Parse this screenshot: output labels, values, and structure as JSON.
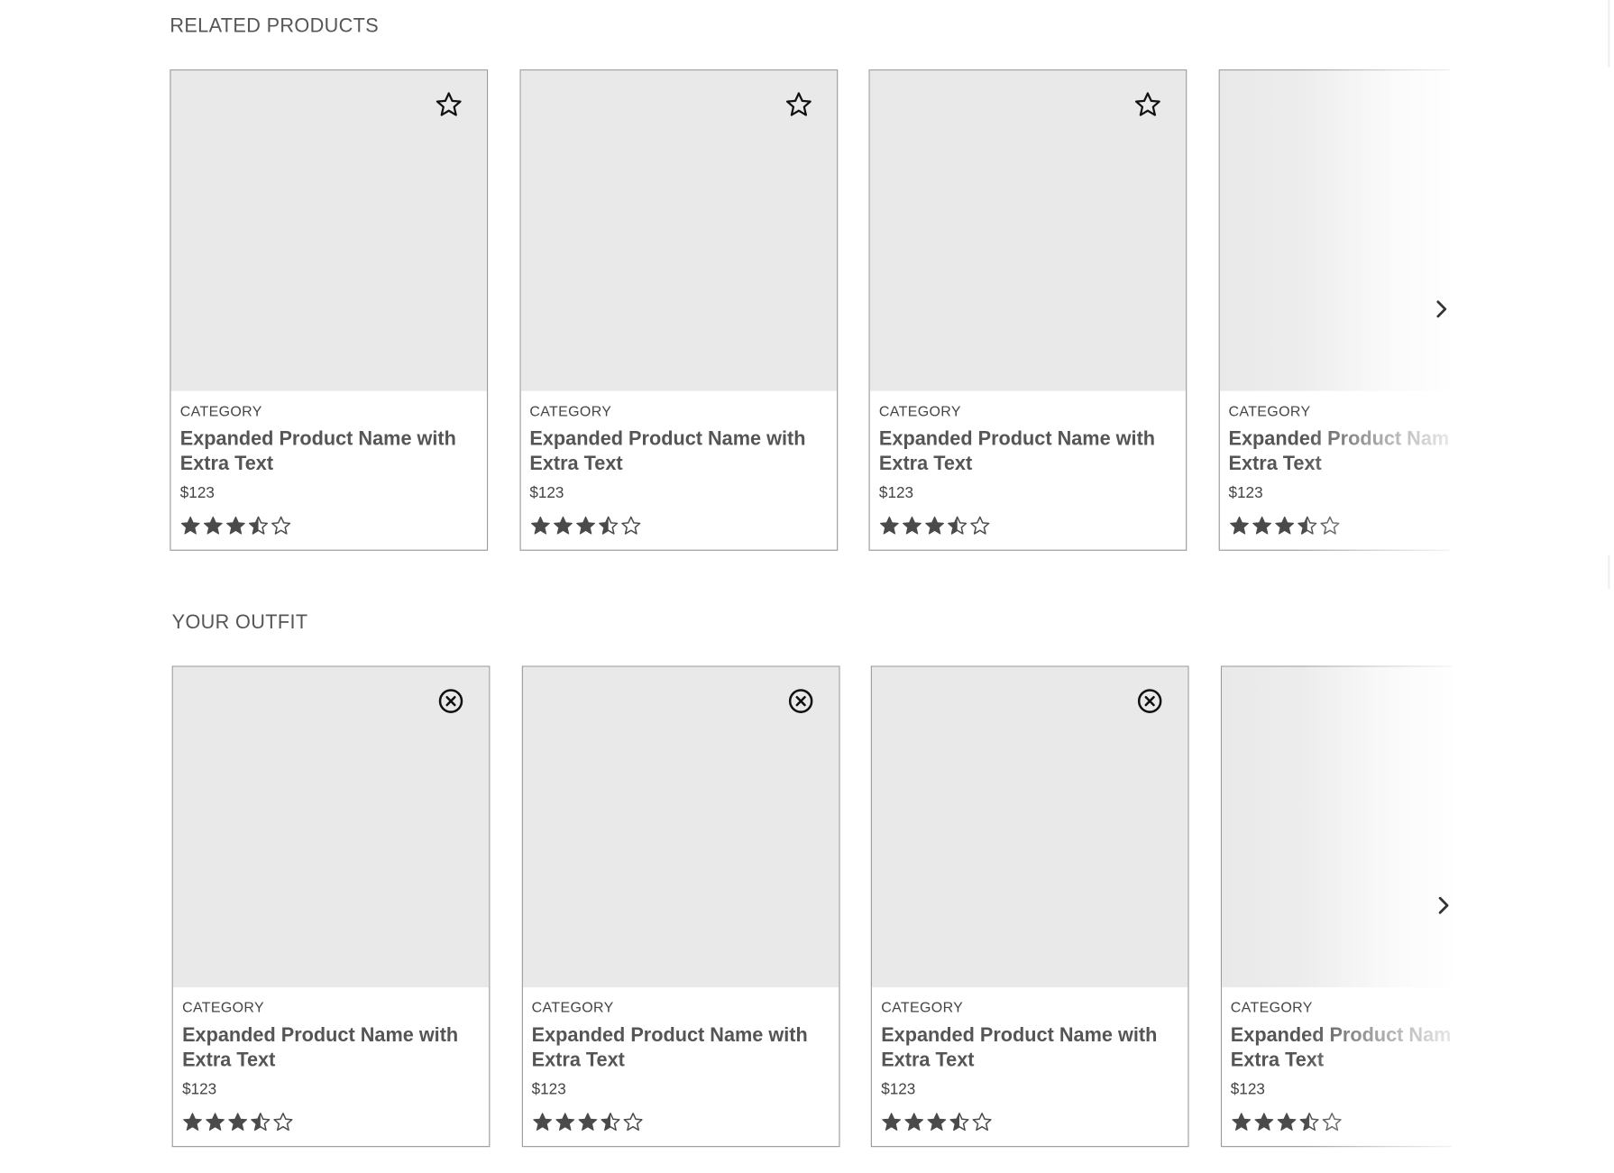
{
  "related": {
    "title": "RELATED PRODUCTS",
    "action_icon": "star-outline-icon",
    "next_icon": "chevron-right-icon",
    "cards": [
      {
        "category": "CATEGORY",
        "name": "Expanded Product Name with Extra Text",
        "price": "$123",
        "rating": 3.5,
        "max_rating": 5
      },
      {
        "category": "CATEGORY",
        "name": "Expanded Product Name with Extra Text",
        "price": "$123",
        "rating": 3.5,
        "max_rating": 5
      },
      {
        "category": "CATEGORY",
        "name": "Expanded Product Name with Extra Text",
        "price": "$123",
        "rating": 3.5,
        "max_rating": 5
      },
      {
        "category": "CATEGORY",
        "name": "Expanded Product Name with Extra Text",
        "price": "$123",
        "rating": 3.5,
        "max_rating": 5
      }
    ]
  },
  "outfit": {
    "title": "YOUR OUTFIT",
    "action_icon": "remove-circle-x-icon",
    "next_icon": "chevron-right-icon",
    "cards": [
      {
        "category": "CATEGORY",
        "name": "Expanded Product Name with Extra Text",
        "price": "$123",
        "rating": 3.5,
        "max_rating": 5
      },
      {
        "category": "CATEGORY",
        "name": "Expanded Product Name with Extra Text",
        "price": "$123",
        "rating": 3.5,
        "max_rating": 5
      },
      {
        "category": "CATEGORY",
        "name": "Expanded Product Name with Extra Text",
        "price": "$123",
        "rating": 3.5,
        "max_rating": 5
      },
      {
        "category": "CATEGORY",
        "name": "Expanded Product Name with Extra Text",
        "price": "$123",
        "rating": 3.5,
        "max_rating": 5
      }
    ]
  },
  "colors": {
    "image_placeholder": "#e9e9e9",
    "card_border": "#9a9a9a",
    "star_fill": "#4a4a4a",
    "text": "#555555"
  }
}
